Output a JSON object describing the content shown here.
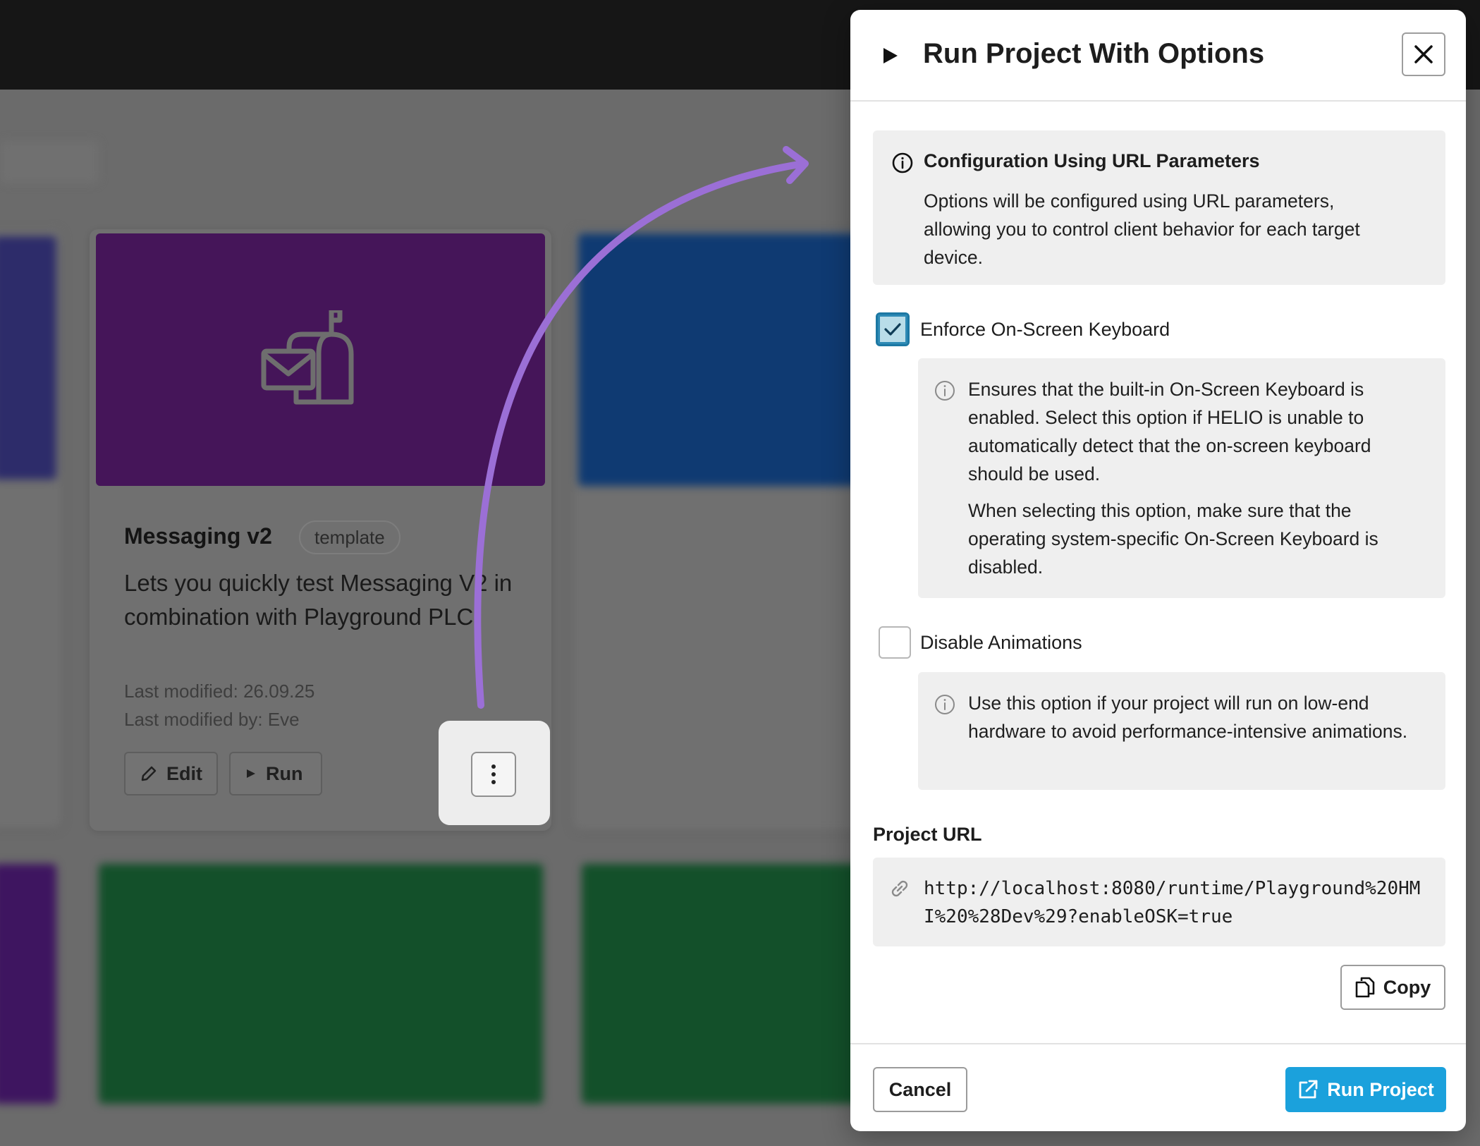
{
  "background": {
    "card": {
      "title": "Messaging v2",
      "tag": "template",
      "description": "Lets you quickly test Messaging V2 in combination with Playground PLC",
      "last_modified": "Last modified: 26.09.25",
      "last_modified_by": "Last modified by: Eve",
      "edit_label": "Edit",
      "run_label": "Run"
    }
  },
  "modal": {
    "title": "Run Project With Options",
    "info": {
      "title": "Configuration Using URL Parameters",
      "text": "Options will be configured using URL parameters, allowing you to control client behavior for each target device."
    },
    "options": [
      {
        "label": "Enforce On-Screen Keyboard",
        "checked": true,
        "help": [
          "Ensures that the built-in On-Screen Keyboard is enabled. Select this option if HELIO is unable to automatically detect that the on-screen keyboard should be used.",
          "When selecting this option, make sure that the operating system-specific On-Screen Keyboard is disabled."
        ]
      },
      {
        "label": "Disable Animations",
        "checked": false,
        "help": [
          "Use this option if your project will run on low-end hardware to avoid performance-intensive animations."
        ]
      }
    ],
    "url_label": "Project URL",
    "url": "http://localhost:8080/runtime/Playground%20HMI%20%28Dev%29?enableOSK=true",
    "copy_label": "Copy",
    "cancel_label": "Cancel",
    "run_label": "Run Project"
  },
  "colors": {
    "accent": "#1ba1dc",
    "checkbox_border": "#1c78a3",
    "annotation_arrow": "#9b6fd6",
    "thumb_purple": "#451559"
  }
}
